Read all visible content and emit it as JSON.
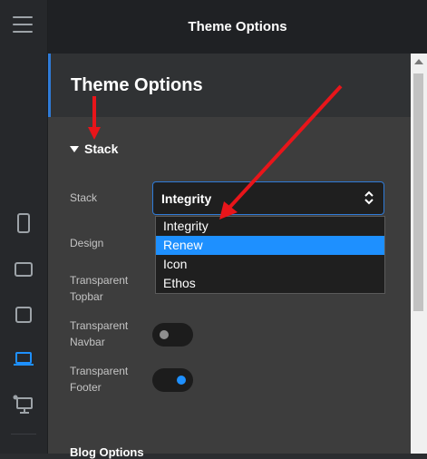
{
  "header": {
    "title": "Theme Options"
  },
  "panel": {
    "heading": "Theme Options",
    "section": {
      "title": "Stack"
    },
    "stack": {
      "label": "Stack",
      "selected": "Integrity",
      "options": [
        "Integrity",
        "Renew",
        "Icon",
        "Ethos"
      ],
      "highlighted": "Renew"
    },
    "design": {
      "label": "Design"
    },
    "transparent_topbar": {
      "label_1": "Transparent",
      "label_2": "Topbar"
    },
    "transparent_navbar": {
      "label_1": "Transparent",
      "label_2": "Navbar",
      "enabled": false
    },
    "transparent_footer": {
      "label_1": "Transparent",
      "label_2": "Footer",
      "enabled": true
    },
    "next_section_partial": "Blog Options"
  },
  "rail": {
    "icons": [
      "menu-icon",
      "phone-icon",
      "tablet-landscape-icon",
      "tablet-icon",
      "laptop-icon",
      "desktop-icon"
    ],
    "active": "laptop-icon"
  },
  "colors": {
    "accent": "#2f7bd8",
    "highlight": "#1e90ff",
    "annotation": "#e8151a"
  }
}
